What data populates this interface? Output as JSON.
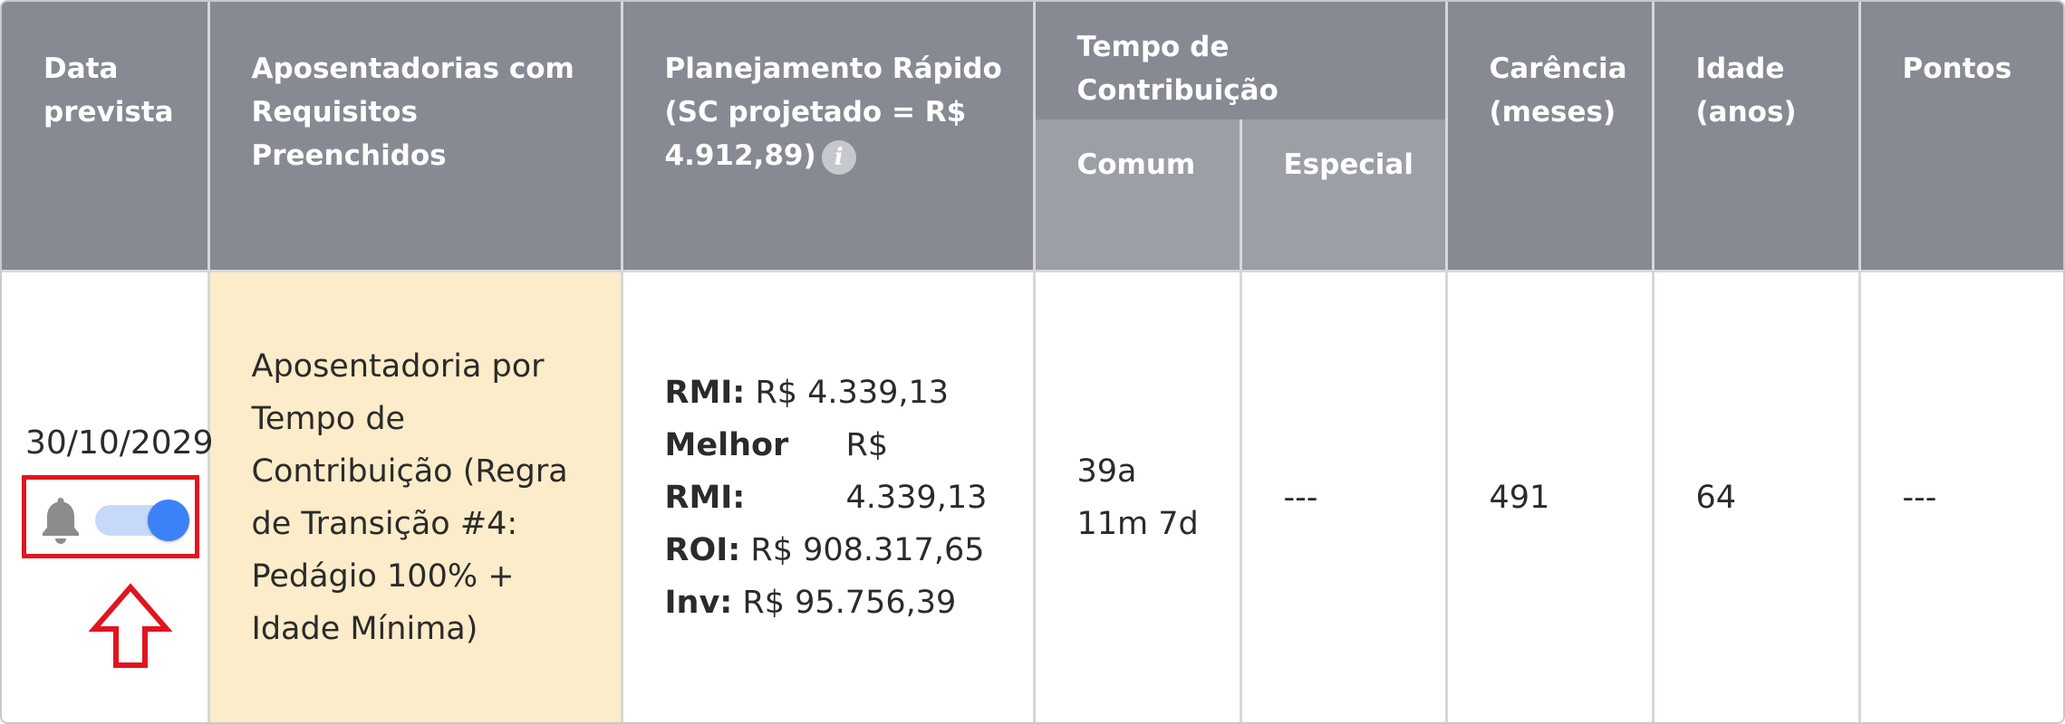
{
  "header": {
    "data_prevista": "Data prevista",
    "aposentadorias": "Aposentadorias com Requisitos Preenchidos",
    "planejamento": "Planejamento Rápido (SC projetado = R$ 4.912,89)",
    "info_icon": "info-icon",
    "tempo_contribuicao": "Tempo de Contribuição",
    "comum": "Comum",
    "especial": "Especial",
    "carencia": "Carência (meses)",
    "idade": "Idade (anos)",
    "pontos": "Pontos"
  },
  "row": {
    "date": "30/10/2029",
    "alert_enabled": true,
    "aposentadoria": "Aposentadoria por Tempo de Contribuição (Regra de Transição #4: Pedágio 100% + Idade Mínima)",
    "rmi_label": "RMI:",
    "rmi_value": "R$ 4.339,13",
    "melhor_rmi_label_1": "Melhor",
    "melhor_rmi_label_2": "RMI:",
    "melhor_rmi_value_1": "R$",
    "melhor_rmi_value_2": "4.339,13",
    "roi_label": "ROI:",
    "roi_value": "R$ 908.317,65",
    "inv_label": "Inv:",
    "inv_value": "R$ 95.756,39",
    "tempo_comum_1": "39a",
    "tempo_comum_2": "11m 7d",
    "tempo_especial": "---",
    "carencia": "491",
    "idade": "64",
    "pontos": "---"
  },
  "colors": {
    "header_bg": "#878a93",
    "subheader_bg": "#9d9fa6",
    "highlight_bg": "#fcecc9",
    "toggle_on": "#3b82f6",
    "annotation_red": "#e0151f"
  }
}
